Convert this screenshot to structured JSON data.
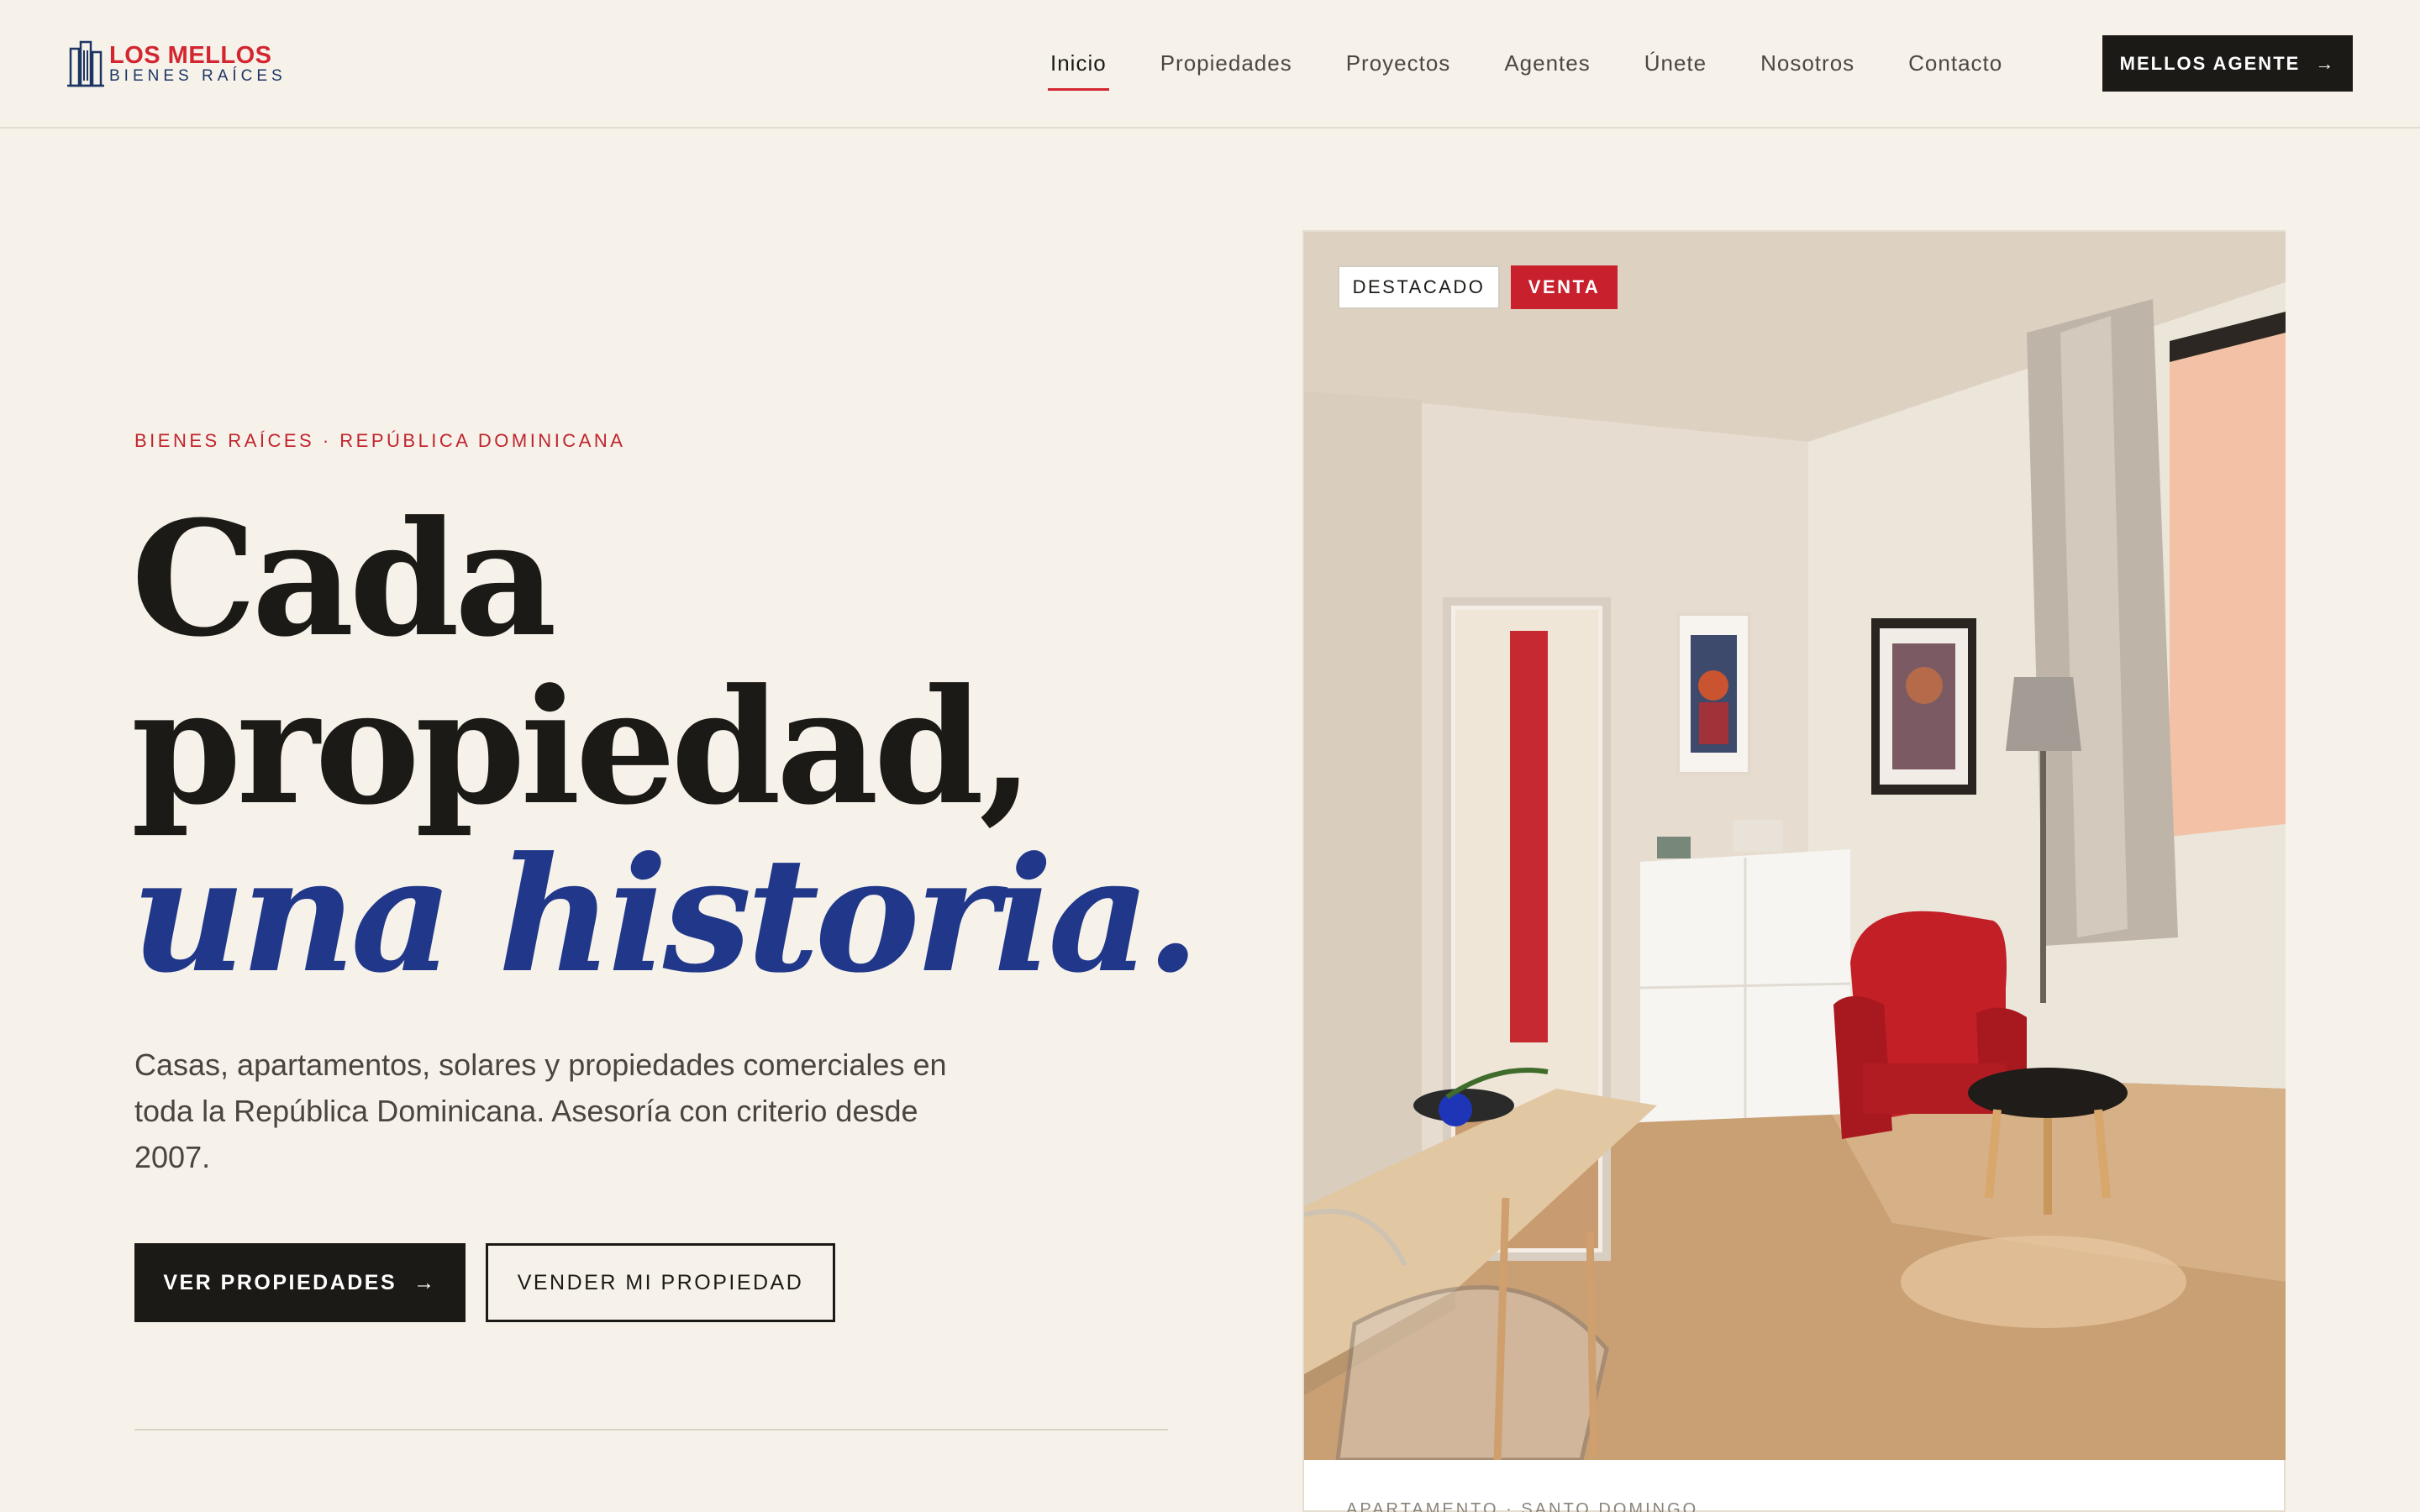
{
  "brand": {
    "name": "LOS MELLOS",
    "tagline": "BIENES RAÍCES"
  },
  "nav": {
    "items": [
      {
        "label": "Inicio",
        "active": true
      },
      {
        "label": "Propiedades"
      },
      {
        "label": "Proyectos"
      },
      {
        "label": "Agentes"
      },
      {
        "label": "Únete"
      },
      {
        "label": "Nosotros"
      },
      {
        "label": "Contacto"
      }
    ],
    "cta_label": "MELLOS AGENTE",
    "cta_arrow": "→"
  },
  "hero": {
    "eyebrow": "BIENES RAÍCES · REPÚBLICA DOMINICANA",
    "headline_line1": "Cada",
    "headline_line2": "propiedad,",
    "headline_line3": "una historia.",
    "lead": "Casas, apartamentos, solares y propiedades comerciales en toda la República Dominicana. Asesoría con criterio desde 2007.",
    "primary_cta": "VER PROPIEDADES",
    "primary_arrow": "→",
    "secondary_cta": "VENDER MI PROPIEDAD"
  },
  "featured_card": {
    "badge_featured": "DESTACADO",
    "badge_sale": "VENTA",
    "meta": "APARTAMENTO · SANTO DOMINGO"
  },
  "colors": {
    "accent_red": "#d32630",
    "accent_blue": "#21388a",
    "background": "#f6f2ea",
    "dark": "#1c1a17"
  }
}
